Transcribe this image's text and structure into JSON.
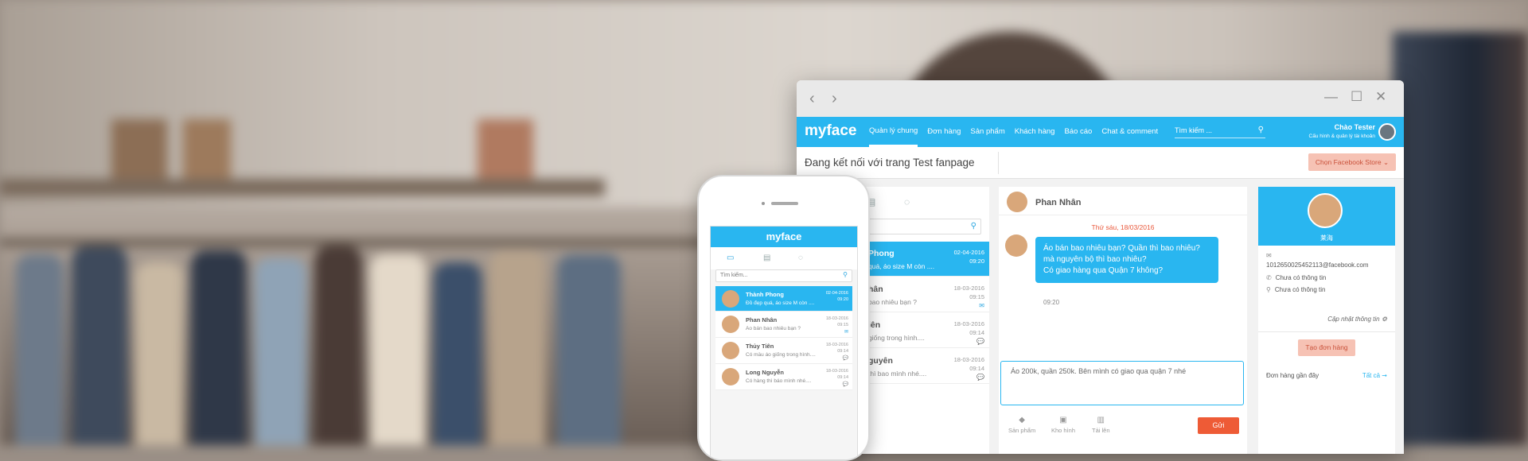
{
  "window": {
    "nav_back": "‹",
    "nav_fwd": "›",
    "minimize": "—",
    "maximize": "☐",
    "close": "✕"
  },
  "app": {
    "logo": "myface",
    "menu": [
      "Quản lý chung",
      "Đơn hàng",
      "Sản phẩm",
      "Khách hàng",
      "Báo cáo",
      "Chat & comment"
    ],
    "active_menu": "Quản lý chung",
    "search_placeholder": "Tìm kiếm ...",
    "greeting": "Chào Tester",
    "user_sub": "Cấu hình & quản lý tài khoản"
  },
  "subbar": {
    "title": "Đang kết nối với trang Test fanpage",
    "store_button": "Chọn Facebook Store ⌄"
  },
  "conversations": [
    {
      "name": "Phong",
      "msg": "quá, áo size M còn ....",
      "date": "02-04-2016",
      "time": "09:20",
      "selected": true
    },
    {
      "name": "hân",
      "msg": "bao nhiêu bạn ?",
      "date": "18-03-2016",
      "time": "09:15",
      "icon": "✉"
    },
    {
      "name": "iên",
      "msg": "giống trong hình....",
      "date": "18-03-2016",
      "time": "09:14",
      "icon": "💬"
    },
    {
      "name": "guyên",
      "msg": "thì bao mình nhé....",
      "date": "18-03-2016",
      "time": "09:14",
      "icon": "💬"
    }
  ],
  "chat": {
    "contact": "Phan Nhân",
    "date_divider": "Thứ sáu, 18/03/2016",
    "message_lines": [
      "Áo bán bao nhiêu bạn? Quần thì bao nhiêu?",
      "mà nguyên bộ thì bao nhiêu?",
      "Có giao hàng qua Quận 7 không?"
    ],
    "message_time": "09:20",
    "compose_text": "Áo 200k, quần 250k. Bên mình có giao qua quận 7 nhé",
    "tools": [
      "Sản phẩm",
      "Kho hình",
      "Tải lên"
    ],
    "send": "Gửi"
  },
  "profile": {
    "name": "莱海",
    "email": "1012650025452113@facebook.com",
    "phone": "Chưa có thông tin",
    "address": "Chưa có thông tin",
    "update_link": "Cập nhật thông tin",
    "create_order": "Tạo đơn hàng",
    "recent_orders": "Đơn hàng gần đây",
    "all_link": "Tất cả"
  },
  "phone": {
    "title": "myface",
    "search_placeholder": "Tìm kiếm...",
    "rows": [
      {
        "name": "Thành Phong",
        "msg": "Đồ đẹp quá, áo size M còn ....",
        "date": "02-04-2016",
        "time": "09:20",
        "selected": true
      },
      {
        "name": "Phan Nhân",
        "msg": "Áo bán bao nhiêu bạn ?",
        "date": "18-03-2016",
        "time": "09:15",
        "icon": "✉"
      },
      {
        "name": "Thủy Tiên",
        "msg": "Có mẫu áo giống trong hình....",
        "date": "18-03-2016",
        "time": "09:14",
        "icon": "💬"
      },
      {
        "name": "Long Nguyễn",
        "msg": "Có hàng thì báo mình nhé....",
        "date": "18-03-2016",
        "time": "09:14",
        "icon": "💬"
      }
    ]
  },
  "colors": {
    "accent": "#29b6f0",
    "danger": "#ee5b36",
    "soft_button": "#f6c2b4"
  }
}
